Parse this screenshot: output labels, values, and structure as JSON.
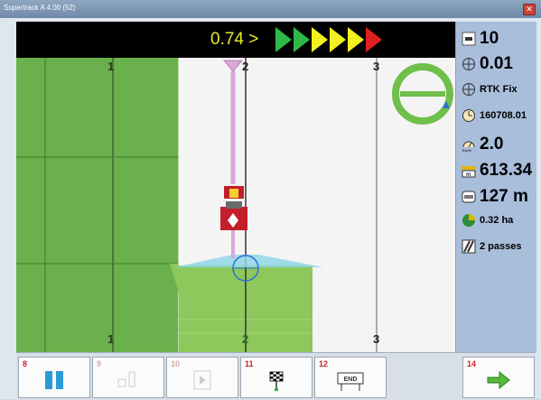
{
  "window": {
    "title": "Supertrack A 4.00 (52)"
  },
  "guidance": {
    "cross_track_error": "0.74 >"
  },
  "map": {
    "line_labels_top": [
      "1",
      "2",
      "3"
    ],
    "line_labels_bottom": [
      "1",
      "2",
      "3"
    ]
  },
  "stats": {
    "satellites": "10",
    "precision": "0.01",
    "fix": "RTK Fix",
    "time": "160708.01",
    "speed": "2.0",
    "distance": "613.34",
    "line_distance": "127 m",
    "area": "0.32 ha",
    "passes": "2 passes"
  },
  "toolbar": [
    {
      "num": "8",
      "icon": "pause-icon",
      "enabled": true
    },
    {
      "num": "9",
      "icon": "ab-line-icon",
      "enabled": false
    },
    {
      "num": "10",
      "icon": "play-icon",
      "enabled": false
    },
    {
      "num": "11",
      "icon": "checkered-flag-icon",
      "enabled": true
    },
    {
      "num": "12",
      "icon": "end-flag-icon",
      "enabled": true,
      "label": "END"
    },
    {
      "num": "14",
      "icon": "arrow-right-icon",
      "enabled": true
    }
  ],
  "colors": {
    "field_green": "#6ab04c",
    "coverage_green": "#8dc85c",
    "spray_blue": "#8fd6e6",
    "tractor_red": "#c41e2b"
  }
}
